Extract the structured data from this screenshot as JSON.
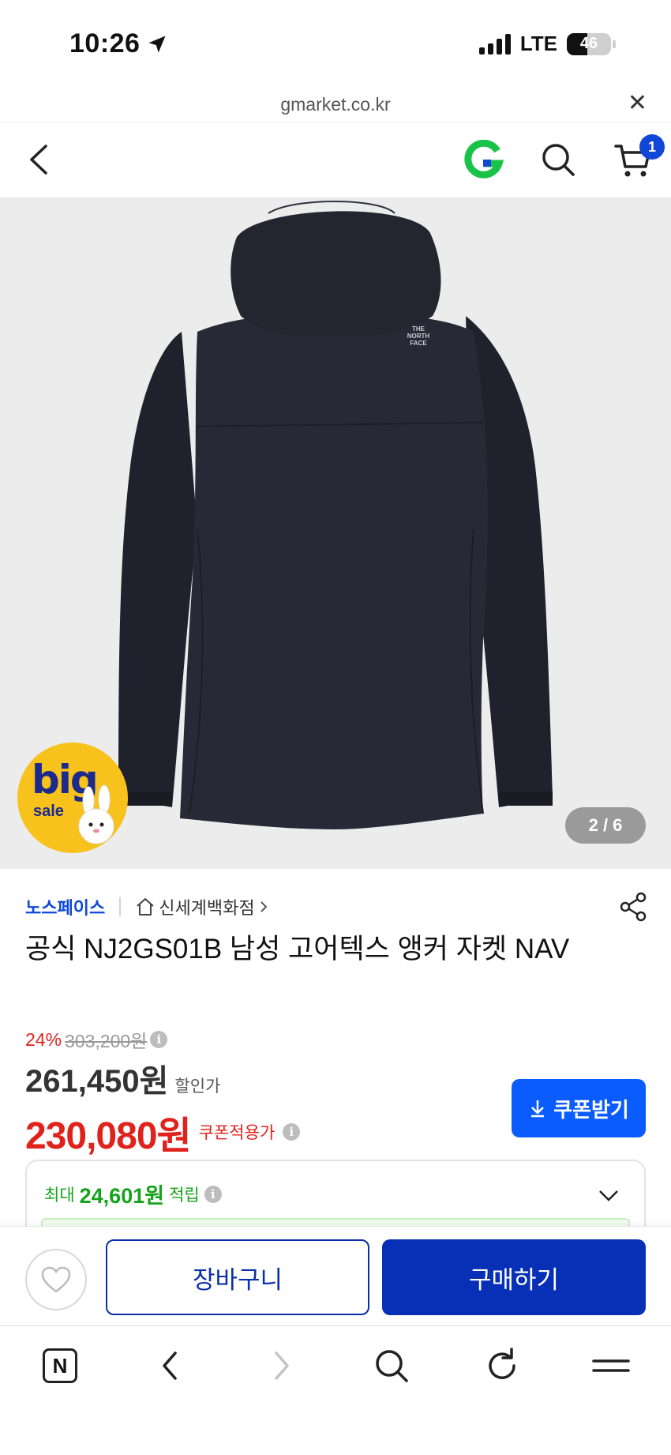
{
  "status_bar": {
    "time": "10:26",
    "network": "LTE",
    "battery": "46",
    "battery_level": 0.46
  },
  "url_bar": {
    "domain": "gmarket.co.kr",
    "close_icon": "close-icon"
  },
  "header": {
    "cart_count": "1",
    "icons": [
      "back-icon",
      "gmarket-logo-icon",
      "search-icon",
      "cart-icon"
    ]
  },
  "gallery": {
    "counter": "2 / 6",
    "badge_big": "big",
    "badge_sale": "sale",
    "jacket_logo": [
      "THE",
      "NORTH",
      "FACE"
    ]
  },
  "product": {
    "brand": "노스페이스",
    "store": "신세계백화점",
    "title": "공식 NJ2GS01B 남성 고어텍스 앵커 자켓 NAV"
  },
  "price": {
    "discount_rate": "24%",
    "original_price": "303,200원",
    "sale_price": "261,450원",
    "sale_label": "할인가",
    "coupon_price": "230,080원",
    "coupon_label": "쿠폰적용가",
    "coupon_button": "쿠폰받기",
    "info_glyph": "i"
  },
  "reward": {
    "prefix": "최대",
    "amount": "24,601원",
    "suffix": "적립"
  },
  "actions": {
    "cart_label": "장바구니",
    "buy_label": "구매하기"
  },
  "browser_toolbar": {
    "icons": [
      "naver-home-icon",
      "back-icon",
      "forward-icon",
      "search-icon",
      "refresh-icon",
      "menu-icon"
    ],
    "home_glyph": "N"
  },
  "colors": {
    "accent": "#0a5cff",
    "brand_blue": "#1047d6",
    "buy_blue": "#0730b6",
    "sale_red": "#e0221d",
    "reward_green": "#15a31b",
    "badge_yellow": "#f6c21b"
  }
}
